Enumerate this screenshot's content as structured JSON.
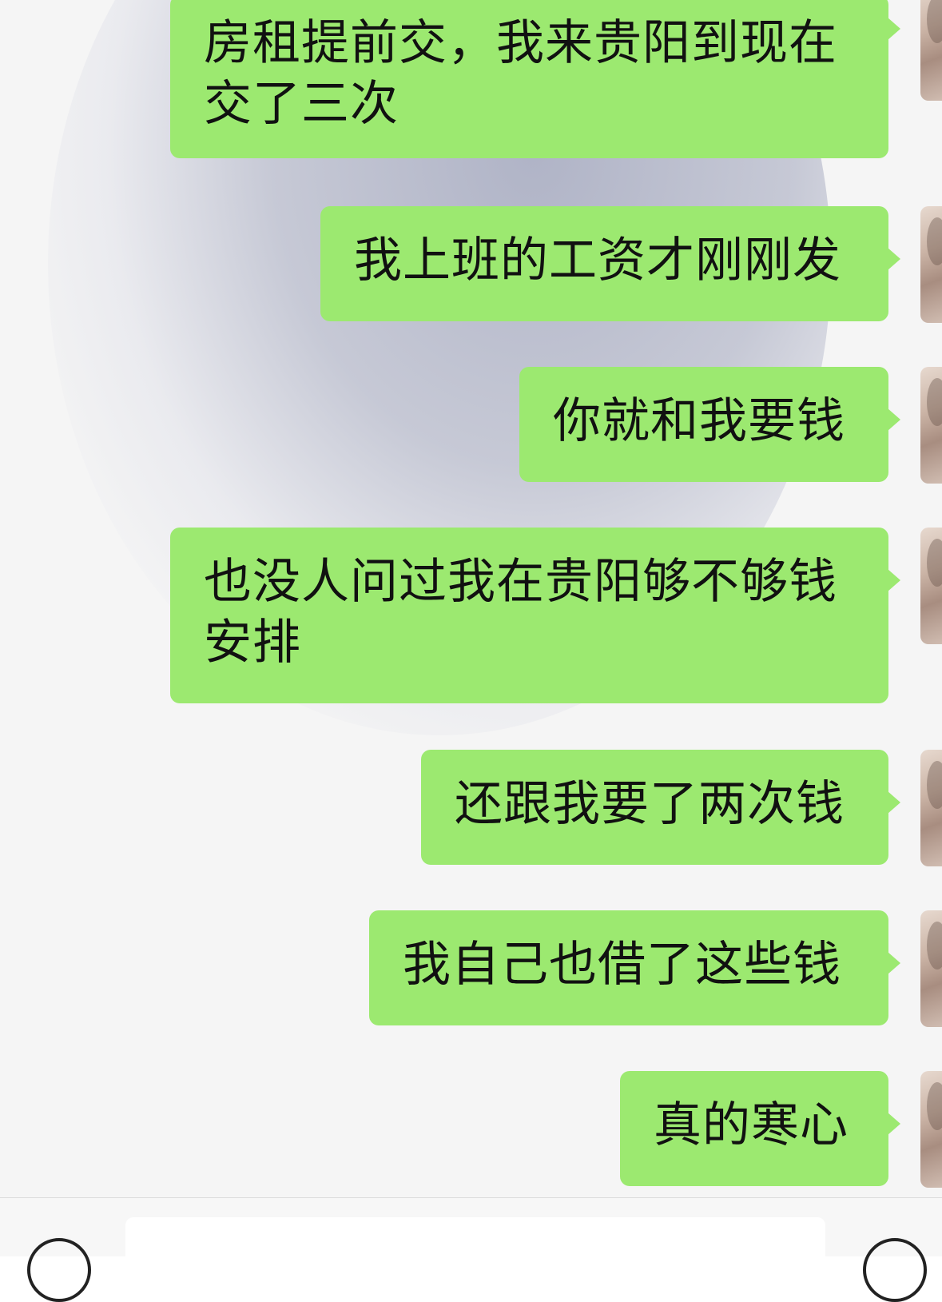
{
  "messages": [
    {
      "text": "房租提前交，我来贵阳到现在交了三次"
    },
    {
      "text": "我上班的工资才刚刚发"
    },
    {
      "text": "你就和我要钱"
    },
    {
      "text": "也没人问过我在贵阳够不够钱安排"
    },
    {
      "text": "还跟我要了两次钱"
    },
    {
      "text": "我自己也借了这些钱"
    },
    {
      "text": "真的寒心"
    }
  ],
  "colors": {
    "bubble_sent": "#9ce970",
    "chat_background": "#f5f5f5"
  },
  "icons": {
    "voice": "voice-icon",
    "emoji": "emoji-icon"
  }
}
